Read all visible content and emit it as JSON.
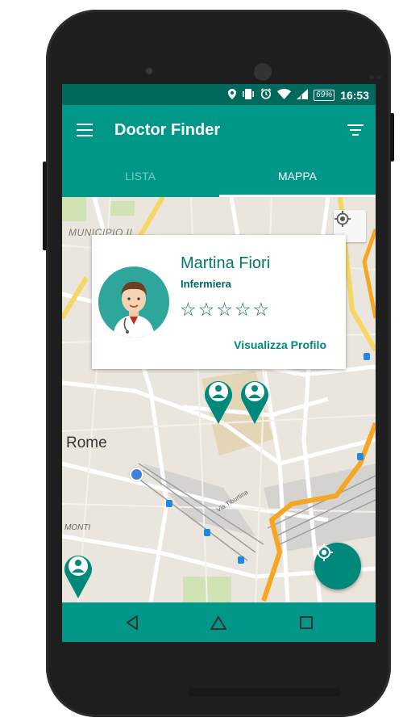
{
  "status_bar": {
    "battery": "69%",
    "time": "16:53",
    "icons": [
      "location-icon",
      "vibrate-icon",
      "alarm-icon",
      "wifi-icon",
      "signal-icon",
      "battery-icon"
    ]
  },
  "app_bar": {
    "title": "Doctor Finder",
    "menu_icon": "hamburger-menu-icon",
    "filter_icon": "filter-icon"
  },
  "tabs": [
    {
      "label": "LISTA",
      "selected": false
    },
    {
      "label": "MAPPA",
      "selected": true
    }
  ],
  "map": {
    "labels": {
      "municipio": "MUNICIPIO II",
      "city": "Rome",
      "district": "MONTI",
      "street": "Via Tiburtina"
    }
  },
  "doctor_card": {
    "name": "Martina Fiori",
    "role": "Infermiera",
    "rating": 0,
    "max_rating": 5,
    "star_glyph": "☆",
    "profile_link": "Visualizza Profilo"
  },
  "colors": {
    "primary": "#009688",
    "primary_dark": "#00695c",
    "accent_text": "#00897b"
  },
  "nav_bar": {
    "buttons": [
      "back-icon",
      "home-icon",
      "recents-icon"
    ]
  }
}
